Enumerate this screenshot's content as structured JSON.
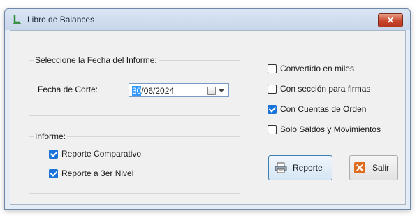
{
  "window": {
    "title": "Libro de Balances",
    "close_glyph": "✕",
    "app_icon": "app-icon",
    "title_color": "#1b2a3a",
    "close_color": "#c9462c"
  },
  "fecha_group": {
    "title": "Seleccione la Fecha del Informe:",
    "label": "Fecha de Corte:",
    "date_selected": "30",
    "date_rest": "/06/2024",
    "calendar_icon": "calendar-icon",
    "dropdown_icon": "chevron-down-icon"
  },
  "informe_group": {
    "title": "Informe:",
    "items": [
      {
        "label": "Reporte Comparativo",
        "checked": true
      },
      {
        "label": "Reporte a 3er Nivel",
        "checked": true
      }
    ]
  },
  "options": [
    {
      "label": "Convertido en miles",
      "checked": false
    },
    {
      "label": "Con sección para firmas",
      "checked": false
    },
    {
      "label": "Con Cuentas de Orden",
      "checked": true
    },
    {
      "label": "Solo Saldos y Movimientos",
      "checked": false
    }
  ],
  "buttons": {
    "reporte": {
      "label": "Reporte",
      "icon": "printer-icon"
    },
    "salir": {
      "label": "Salir",
      "icon": "close-icon"
    }
  },
  "colors": {
    "check_accent": "#1a73d9",
    "selection": "#3399ff",
    "salir_icon": "#e06a1d"
  }
}
